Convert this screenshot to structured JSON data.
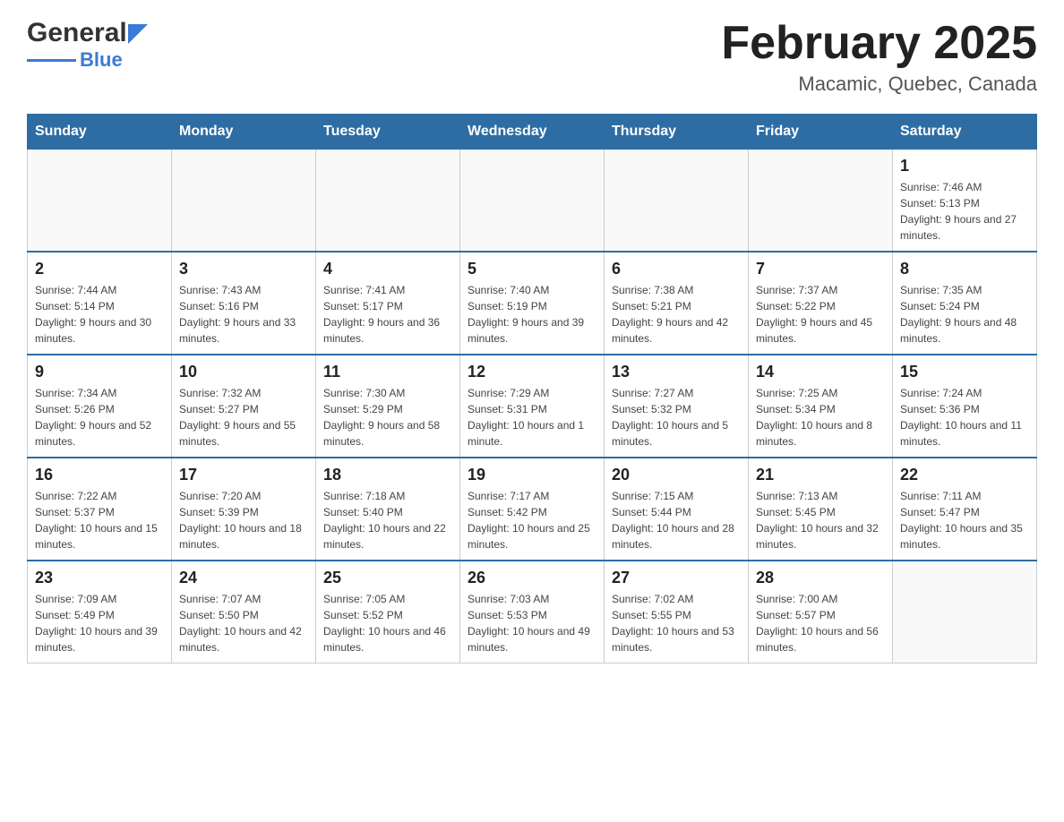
{
  "header": {
    "logo_general": "General",
    "logo_blue": "Blue",
    "title": "February 2025",
    "subtitle": "Macamic, Quebec, Canada"
  },
  "weekdays": [
    "Sunday",
    "Monday",
    "Tuesday",
    "Wednesday",
    "Thursday",
    "Friday",
    "Saturday"
  ],
  "weeks": [
    [
      {
        "day": "",
        "sunrise": "",
        "sunset": "",
        "daylight": ""
      },
      {
        "day": "",
        "sunrise": "",
        "sunset": "",
        "daylight": ""
      },
      {
        "day": "",
        "sunrise": "",
        "sunset": "",
        "daylight": ""
      },
      {
        "day": "",
        "sunrise": "",
        "sunset": "",
        "daylight": ""
      },
      {
        "day": "",
        "sunrise": "",
        "sunset": "",
        "daylight": ""
      },
      {
        "day": "",
        "sunrise": "",
        "sunset": "",
        "daylight": ""
      },
      {
        "day": "1",
        "sunrise": "Sunrise: 7:46 AM",
        "sunset": "Sunset: 5:13 PM",
        "daylight": "Daylight: 9 hours and 27 minutes."
      }
    ],
    [
      {
        "day": "2",
        "sunrise": "Sunrise: 7:44 AM",
        "sunset": "Sunset: 5:14 PM",
        "daylight": "Daylight: 9 hours and 30 minutes."
      },
      {
        "day": "3",
        "sunrise": "Sunrise: 7:43 AM",
        "sunset": "Sunset: 5:16 PM",
        "daylight": "Daylight: 9 hours and 33 minutes."
      },
      {
        "day": "4",
        "sunrise": "Sunrise: 7:41 AM",
        "sunset": "Sunset: 5:17 PM",
        "daylight": "Daylight: 9 hours and 36 minutes."
      },
      {
        "day": "5",
        "sunrise": "Sunrise: 7:40 AM",
        "sunset": "Sunset: 5:19 PM",
        "daylight": "Daylight: 9 hours and 39 minutes."
      },
      {
        "day": "6",
        "sunrise": "Sunrise: 7:38 AM",
        "sunset": "Sunset: 5:21 PM",
        "daylight": "Daylight: 9 hours and 42 minutes."
      },
      {
        "day": "7",
        "sunrise": "Sunrise: 7:37 AM",
        "sunset": "Sunset: 5:22 PM",
        "daylight": "Daylight: 9 hours and 45 minutes."
      },
      {
        "day": "8",
        "sunrise": "Sunrise: 7:35 AM",
        "sunset": "Sunset: 5:24 PM",
        "daylight": "Daylight: 9 hours and 48 minutes."
      }
    ],
    [
      {
        "day": "9",
        "sunrise": "Sunrise: 7:34 AM",
        "sunset": "Sunset: 5:26 PM",
        "daylight": "Daylight: 9 hours and 52 minutes."
      },
      {
        "day": "10",
        "sunrise": "Sunrise: 7:32 AM",
        "sunset": "Sunset: 5:27 PM",
        "daylight": "Daylight: 9 hours and 55 minutes."
      },
      {
        "day": "11",
        "sunrise": "Sunrise: 7:30 AM",
        "sunset": "Sunset: 5:29 PM",
        "daylight": "Daylight: 9 hours and 58 minutes."
      },
      {
        "day": "12",
        "sunrise": "Sunrise: 7:29 AM",
        "sunset": "Sunset: 5:31 PM",
        "daylight": "Daylight: 10 hours and 1 minute."
      },
      {
        "day": "13",
        "sunrise": "Sunrise: 7:27 AM",
        "sunset": "Sunset: 5:32 PM",
        "daylight": "Daylight: 10 hours and 5 minutes."
      },
      {
        "day": "14",
        "sunrise": "Sunrise: 7:25 AM",
        "sunset": "Sunset: 5:34 PM",
        "daylight": "Daylight: 10 hours and 8 minutes."
      },
      {
        "day": "15",
        "sunrise": "Sunrise: 7:24 AM",
        "sunset": "Sunset: 5:36 PM",
        "daylight": "Daylight: 10 hours and 11 minutes."
      }
    ],
    [
      {
        "day": "16",
        "sunrise": "Sunrise: 7:22 AM",
        "sunset": "Sunset: 5:37 PM",
        "daylight": "Daylight: 10 hours and 15 minutes."
      },
      {
        "day": "17",
        "sunrise": "Sunrise: 7:20 AM",
        "sunset": "Sunset: 5:39 PM",
        "daylight": "Daylight: 10 hours and 18 minutes."
      },
      {
        "day": "18",
        "sunrise": "Sunrise: 7:18 AM",
        "sunset": "Sunset: 5:40 PM",
        "daylight": "Daylight: 10 hours and 22 minutes."
      },
      {
        "day": "19",
        "sunrise": "Sunrise: 7:17 AM",
        "sunset": "Sunset: 5:42 PM",
        "daylight": "Daylight: 10 hours and 25 minutes."
      },
      {
        "day": "20",
        "sunrise": "Sunrise: 7:15 AM",
        "sunset": "Sunset: 5:44 PM",
        "daylight": "Daylight: 10 hours and 28 minutes."
      },
      {
        "day": "21",
        "sunrise": "Sunrise: 7:13 AM",
        "sunset": "Sunset: 5:45 PM",
        "daylight": "Daylight: 10 hours and 32 minutes."
      },
      {
        "day": "22",
        "sunrise": "Sunrise: 7:11 AM",
        "sunset": "Sunset: 5:47 PM",
        "daylight": "Daylight: 10 hours and 35 minutes."
      }
    ],
    [
      {
        "day": "23",
        "sunrise": "Sunrise: 7:09 AM",
        "sunset": "Sunset: 5:49 PM",
        "daylight": "Daylight: 10 hours and 39 minutes."
      },
      {
        "day": "24",
        "sunrise": "Sunrise: 7:07 AM",
        "sunset": "Sunset: 5:50 PM",
        "daylight": "Daylight: 10 hours and 42 minutes."
      },
      {
        "day": "25",
        "sunrise": "Sunrise: 7:05 AM",
        "sunset": "Sunset: 5:52 PM",
        "daylight": "Daylight: 10 hours and 46 minutes."
      },
      {
        "day": "26",
        "sunrise": "Sunrise: 7:03 AM",
        "sunset": "Sunset: 5:53 PM",
        "daylight": "Daylight: 10 hours and 49 minutes."
      },
      {
        "day": "27",
        "sunrise": "Sunrise: 7:02 AM",
        "sunset": "Sunset: 5:55 PM",
        "daylight": "Daylight: 10 hours and 53 minutes."
      },
      {
        "day": "28",
        "sunrise": "Sunrise: 7:00 AM",
        "sunset": "Sunset: 5:57 PM",
        "daylight": "Daylight: 10 hours and 56 minutes."
      },
      {
        "day": "",
        "sunrise": "",
        "sunset": "",
        "daylight": ""
      }
    ]
  ]
}
